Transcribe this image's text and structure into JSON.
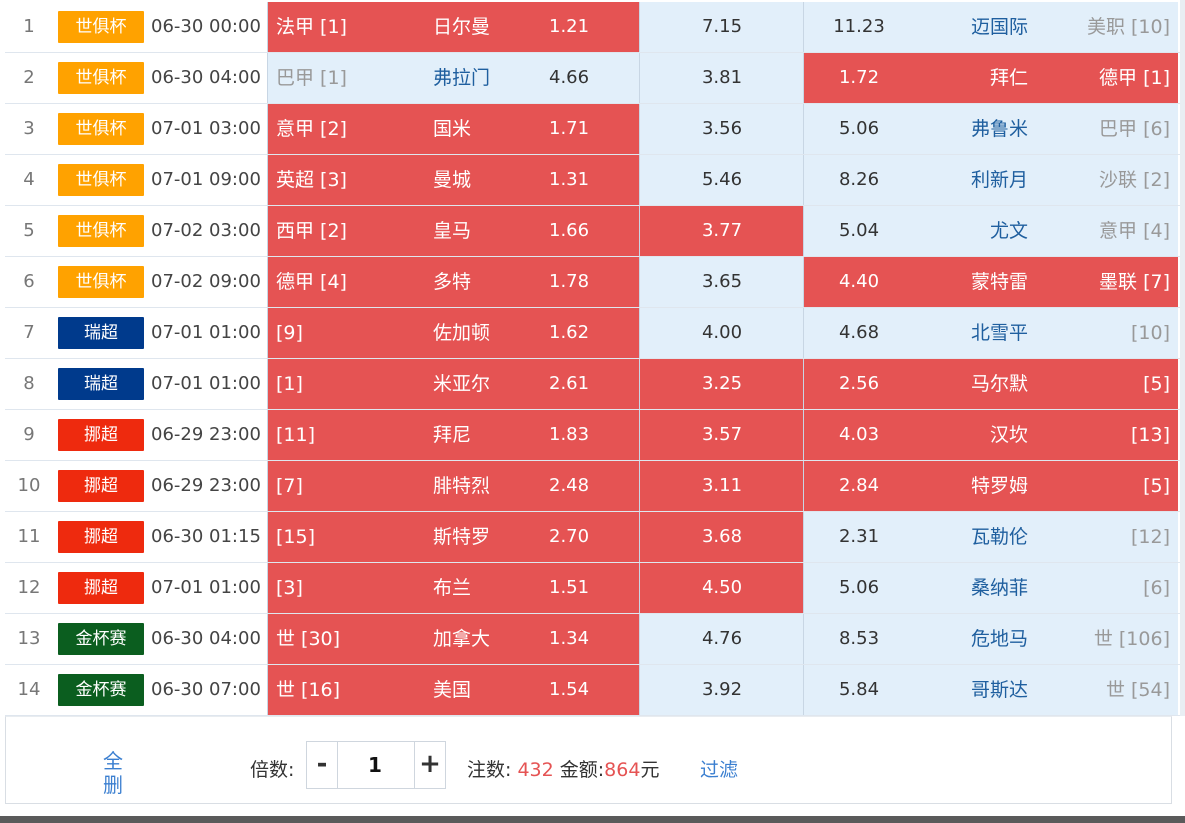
{
  "colors": {
    "selected": "#e55353",
    "unselected": "#e2effa",
    "badge_club_world_cup": "#ffa200",
    "badge_swiss_super": "#003a8c",
    "badge_norway": "#ee2a0e",
    "badge_gold_cup": "#0b5e1f"
  },
  "matches": [
    {
      "idx": "1",
      "league": "世俱杯",
      "badge": "badge_club_world_cup",
      "time": "06-30 00:00",
      "home_rank": "法甲 [1]",
      "home": "日尔曼",
      "home_odds": "1.21",
      "draw": "7.15",
      "away_odds": "11.23",
      "away": "迈国际",
      "away_rank": "美职 [10]",
      "sel": [
        true,
        false,
        false
      ]
    },
    {
      "idx": "2",
      "league": "世俱杯",
      "badge": "badge_club_world_cup",
      "time": "06-30 04:00",
      "home_rank": "巴甲 [1]",
      "home": "弗拉门",
      "home_odds": "4.66",
      "draw": "3.81",
      "away_odds": "1.72",
      "away": "拜仁",
      "away_rank": "德甲 [1]",
      "sel": [
        false,
        false,
        true
      ]
    },
    {
      "idx": "3",
      "league": "世俱杯",
      "badge": "badge_club_world_cup",
      "time": "07-01 03:00",
      "home_rank": "意甲 [2]",
      "home": "国米",
      "home_odds": "1.71",
      "draw": "3.56",
      "away_odds": "5.06",
      "away": "弗鲁米",
      "away_rank": "巴甲 [6]",
      "sel": [
        true,
        false,
        false
      ]
    },
    {
      "idx": "4",
      "league": "世俱杯",
      "badge": "badge_club_world_cup",
      "time": "07-01 09:00",
      "home_rank": "英超 [3]",
      "home": "曼城",
      "home_odds": "1.31",
      "draw": "5.46",
      "away_odds": "8.26",
      "away": "利新月",
      "away_rank": "沙联 [2]",
      "sel": [
        true,
        false,
        false
      ]
    },
    {
      "idx": "5",
      "league": "世俱杯",
      "badge": "badge_club_world_cup",
      "time": "07-02 03:00",
      "home_rank": "西甲 [2]",
      "home": "皇马",
      "home_odds": "1.66",
      "draw": "3.77",
      "away_odds": "5.04",
      "away": "尤文",
      "away_rank": "意甲 [4]",
      "sel": [
        true,
        true,
        false
      ]
    },
    {
      "idx": "6",
      "league": "世俱杯",
      "badge": "badge_club_world_cup",
      "time": "07-02 09:00",
      "home_rank": "德甲 [4]",
      "home": "多特",
      "home_odds": "1.78",
      "draw": "3.65",
      "away_odds": "4.40",
      "away": "蒙特雷",
      "away_rank": "墨联 [7]",
      "sel": [
        true,
        false,
        true
      ]
    },
    {
      "idx": "7",
      "league": "瑞超",
      "badge": "badge_swiss_super",
      "time": "07-01 01:00",
      "home_rank": "[9]",
      "home": "佐加顿",
      "home_odds": "1.62",
      "draw": "4.00",
      "away_odds": "4.68",
      "away": "北雪平",
      "away_rank": "[10]",
      "sel": [
        true,
        false,
        false
      ]
    },
    {
      "idx": "8",
      "league": "瑞超",
      "badge": "badge_swiss_super",
      "time": "07-01 01:00",
      "home_rank": "[1]",
      "home": "米亚尔",
      "home_odds": "2.61",
      "draw": "3.25",
      "away_odds": "2.56",
      "away": "马尔默",
      "away_rank": "[5]",
      "sel": [
        true,
        true,
        true
      ]
    },
    {
      "idx": "9",
      "league": "挪超",
      "badge": "badge_norway",
      "time": "06-29 23:00",
      "home_rank": "[11]",
      "home": "拜尼",
      "home_odds": "1.83",
      "draw": "3.57",
      "away_odds": "4.03",
      "away": "汉坎",
      "away_rank": "[13]",
      "sel": [
        true,
        true,
        true
      ]
    },
    {
      "idx": "10",
      "league": "挪超",
      "badge": "badge_norway",
      "time": "06-29 23:00",
      "home_rank": "[7]",
      "home": "腓特烈",
      "home_odds": "2.48",
      "draw": "3.11",
      "away_odds": "2.84",
      "away": "特罗姆",
      "away_rank": "[5]",
      "sel": [
        true,
        true,
        true
      ]
    },
    {
      "idx": "11",
      "league": "挪超",
      "badge": "badge_norway",
      "time": "06-30 01:15",
      "home_rank": "[15]",
      "home": "斯特罗",
      "home_odds": "2.70",
      "draw": "3.68",
      "away_odds": "2.31",
      "away": "瓦勒伦",
      "away_rank": "[12]",
      "sel": [
        true,
        true,
        false
      ]
    },
    {
      "idx": "12",
      "league": "挪超",
      "badge": "badge_norway",
      "time": "07-01 01:00",
      "home_rank": "[3]",
      "home": "布兰",
      "home_odds": "1.51",
      "draw": "4.50",
      "away_odds": "5.06",
      "away": "桑纳菲",
      "away_rank": "[6]",
      "sel": [
        true,
        true,
        false
      ]
    },
    {
      "idx": "13",
      "league": "金杯赛",
      "badge": "badge_gold_cup",
      "time": "06-30 04:00",
      "home_rank": "世 [30]",
      "home": "加拿大",
      "home_odds": "1.34",
      "draw": "4.76",
      "away_odds": "8.53",
      "away": "危地马",
      "away_rank": "世 [106]",
      "sel": [
        true,
        false,
        false
      ]
    },
    {
      "idx": "14",
      "league": "金杯赛",
      "badge": "badge_gold_cup",
      "time": "06-30 07:00",
      "home_rank": "世 [16]",
      "home": "美国",
      "home_odds": "1.54",
      "draw": "3.92",
      "away_odds": "5.84",
      "away": "哥斯达",
      "away_rank": "世 [54]",
      "sel": [
        true,
        false,
        false
      ]
    }
  ],
  "footer": {
    "delete_all": "全删",
    "multiplier_label": "倍数:",
    "minus": "-",
    "multiplier_value": "1",
    "plus": "+",
    "bets_label": "注数:",
    "bets_value": "432",
    "amount_label": "金额:",
    "amount_value": "864",
    "amount_unit": "元",
    "filter": "过滤"
  }
}
